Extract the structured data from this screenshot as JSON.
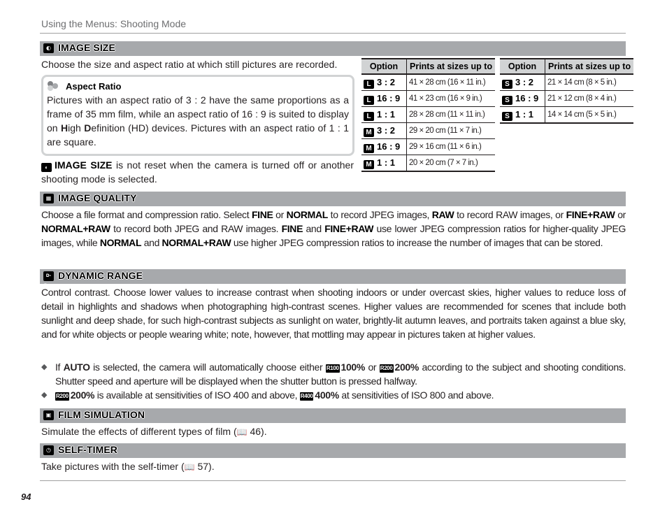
{
  "running_head": "Using the Menus: Shooting Mode",
  "page_number": "94",
  "sections": {
    "image_size": {
      "icon": "image-size-icon",
      "title": "IMAGE SIZE",
      "intro": "Choose the size and aspect ratio at which still pictures are recorded.",
      "note": {
        "icon": "tip-dots-icon",
        "title": "Aspect Ratio",
        "text_1": "Pictures with an aspect ratio of 3 : 2 have the same proportions as a frame of 35 mm film, while an aspect ratio of 16 : 9 is suited to display on ",
        "bold_h": "H",
        "text_2": "igh ",
        "bold_d": "D",
        "text_3": "efinition (HD) devices.  Pictures with an aspect ratio of 1 : 1 are square."
      },
      "reset_note": {
        "bold": "IMAGE SIZE",
        "text": " is not reset when the camera is turned off or another shooting mode is selected."
      },
      "table_headers": {
        "option": "Option",
        "prints": "Prints at sizes up to"
      },
      "table_left": [
        {
          "size": "L",
          "ratio": "3 : 2",
          "print": "41 × 28 cm (16 × 11 in.)"
        },
        {
          "size": "L",
          "ratio": "16 : 9",
          "print": "41 × 23 cm (16 × 9 in.)"
        },
        {
          "size": "L",
          "ratio": "1 : 1",
          "print": "28 × 28 cm (11 × 11 in.)"
        },
        {
          "size": "M",
          "ratio": "3 : 2",
          "print": "29 × 20 cm (11 × 7 in.)"
        },
        {
          "size": "M",
          "ratio": "16 : 9",
          "print": "29 × 16 cm (11 × 6 in.)"
        },
        {
          "size": "M",
          "ratio": "1 : 1",
          "print": "20 × 20 cm (7 × 7 in.)"
        }
      ],
      "table_right": [
        {
          "size": "S",
          "ratio": "3 : 2",
          "print": "21 × 14 cm (8 × 5 in.)"
        },
        {
          "size": "S",
          "ratio": "16 : 9",
          "print": "21 × 12 cm (8 × 4 in.)"
        },
        {
          "size": "S",
          "ratio": "1 : 1",
          "print": "14 × 14 cm (5 × 5 in.)"
        }
      ]
    },
    "image_quality": {
      "title": "IMAGE QUALITY",
      "p": [
        "Choose a file format and compression ratio.  Select ",
        "FINE",
        " or ",
        "NORMAL",
        " to record JPEG images, ",
        "RAW",
        " to record RAW images, or ",
        "FINE+RAW",
        " or ",
        "NORMAL+RAW",
        " to record both JPEG and RAW images.  ",
        "FINE",
        " and ",
        "FINE+RAW",
        " use lower JPEG compression ratios for higher-quality JPEG images, while ",
        "NORMAL",
        " and ",
        "NORMAL+RAW",
        " use higher JPEG compression ratios to increase the number of images that can be stored."
      ]
    },
    "dynamic_range": {
      "title": "DYNAMIC RANGE",
      "icon_text": "D-Rng",
      "text": "Control contrast.  Choose lower values to increase contrast when shooting indoors or under overcast skies, higher values to reduce loss of detail in highlights and shadows when photographing high-contrast scenes.  Higher values are recommended for scenes that include both sunlight and deep shade, for such high-contrast subjects as sunlight on water, brightly-lit autumn leaves, and portraits taken against a blue sky, and for white objects or people wearing white; note, however, that mottling may appear in pictures taken at higher values.",
      "bullets": [
        {
          "p1": "If ",
          "b1": "AUTO",
          "p2": " is selected, the camera will automatically choose either ",
          "ic1": "R100",
          "b2": "100%",
          "p3": " or ",
          "ic2": "R200",
          "b3": "200%",
          "p4": " according to the subject and shooting conditions. Shutter speed and aperture will be displayed when the shutter button is pressed halfway."
        },
        {
          "ic1": "R200",
          "b1": "200%",
          "p1": " is available at sensitivities of ISO 400 and above, ",
          "ic2": "R400",
          "b2": "400%",
          "p2": " at sensitivities of ISO 800 and above."
        }
      ]
    },
    "film_simulation": {
      "title": "FILM SIMULATION",
      "text": "Simulate the effects of different types of film (",
      "page_ref": "46",
      "close": ")."
    },
    "self_timer": {
      "title": "SELF-TIMER",
      "text": "Take pictures with the self-timer (",
      "page_ref": "57",
      "close": ")."
    }
  },
  "colors": {
    "section_bar": "#a7a9ac",
    "table_header": "#d1d3d4",
    "note_border": "#d1d3d4",
    "text": "#231f20"
  }
}
